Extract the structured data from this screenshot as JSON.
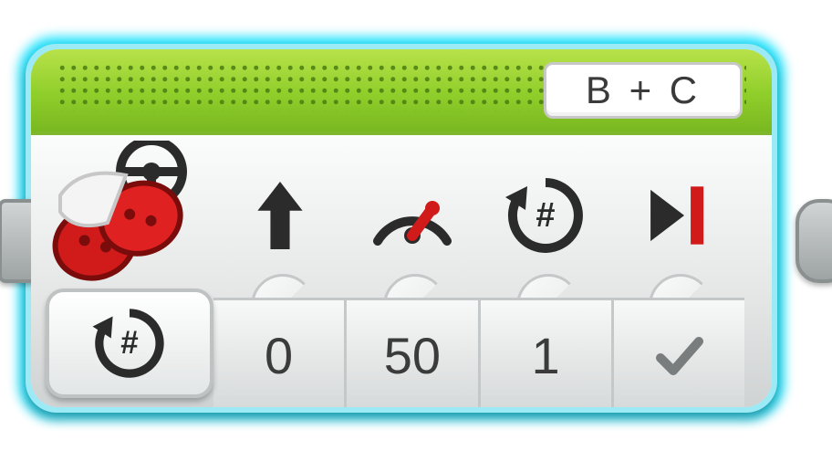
{
  "block": {
    "title_icon": "move-steering-motor",
    "header_color": "#8fce2a",
    "port_selector": "B + C",
    "mode_icon": "rotations-mode",
    "param_icons": [
      "steering-wheel-icon",
      "direction-arrow-icon",
      "power-gauge-icon",
      "rotations-count-icon",
      "brake-end-icon"
    ],
    "params": {
      "steering": {
        "label": "Steering",
        "value": "0"
      },
      "power": {
        "label": "Power",
        "value": "50"
      },
      "rotations": {
        "label": "Rotations",
        "value": "1"
      },
      "brake": {
        "label": "Brake",
        "value": "✓",
        "is_check": true
      }
    }
  }
}
